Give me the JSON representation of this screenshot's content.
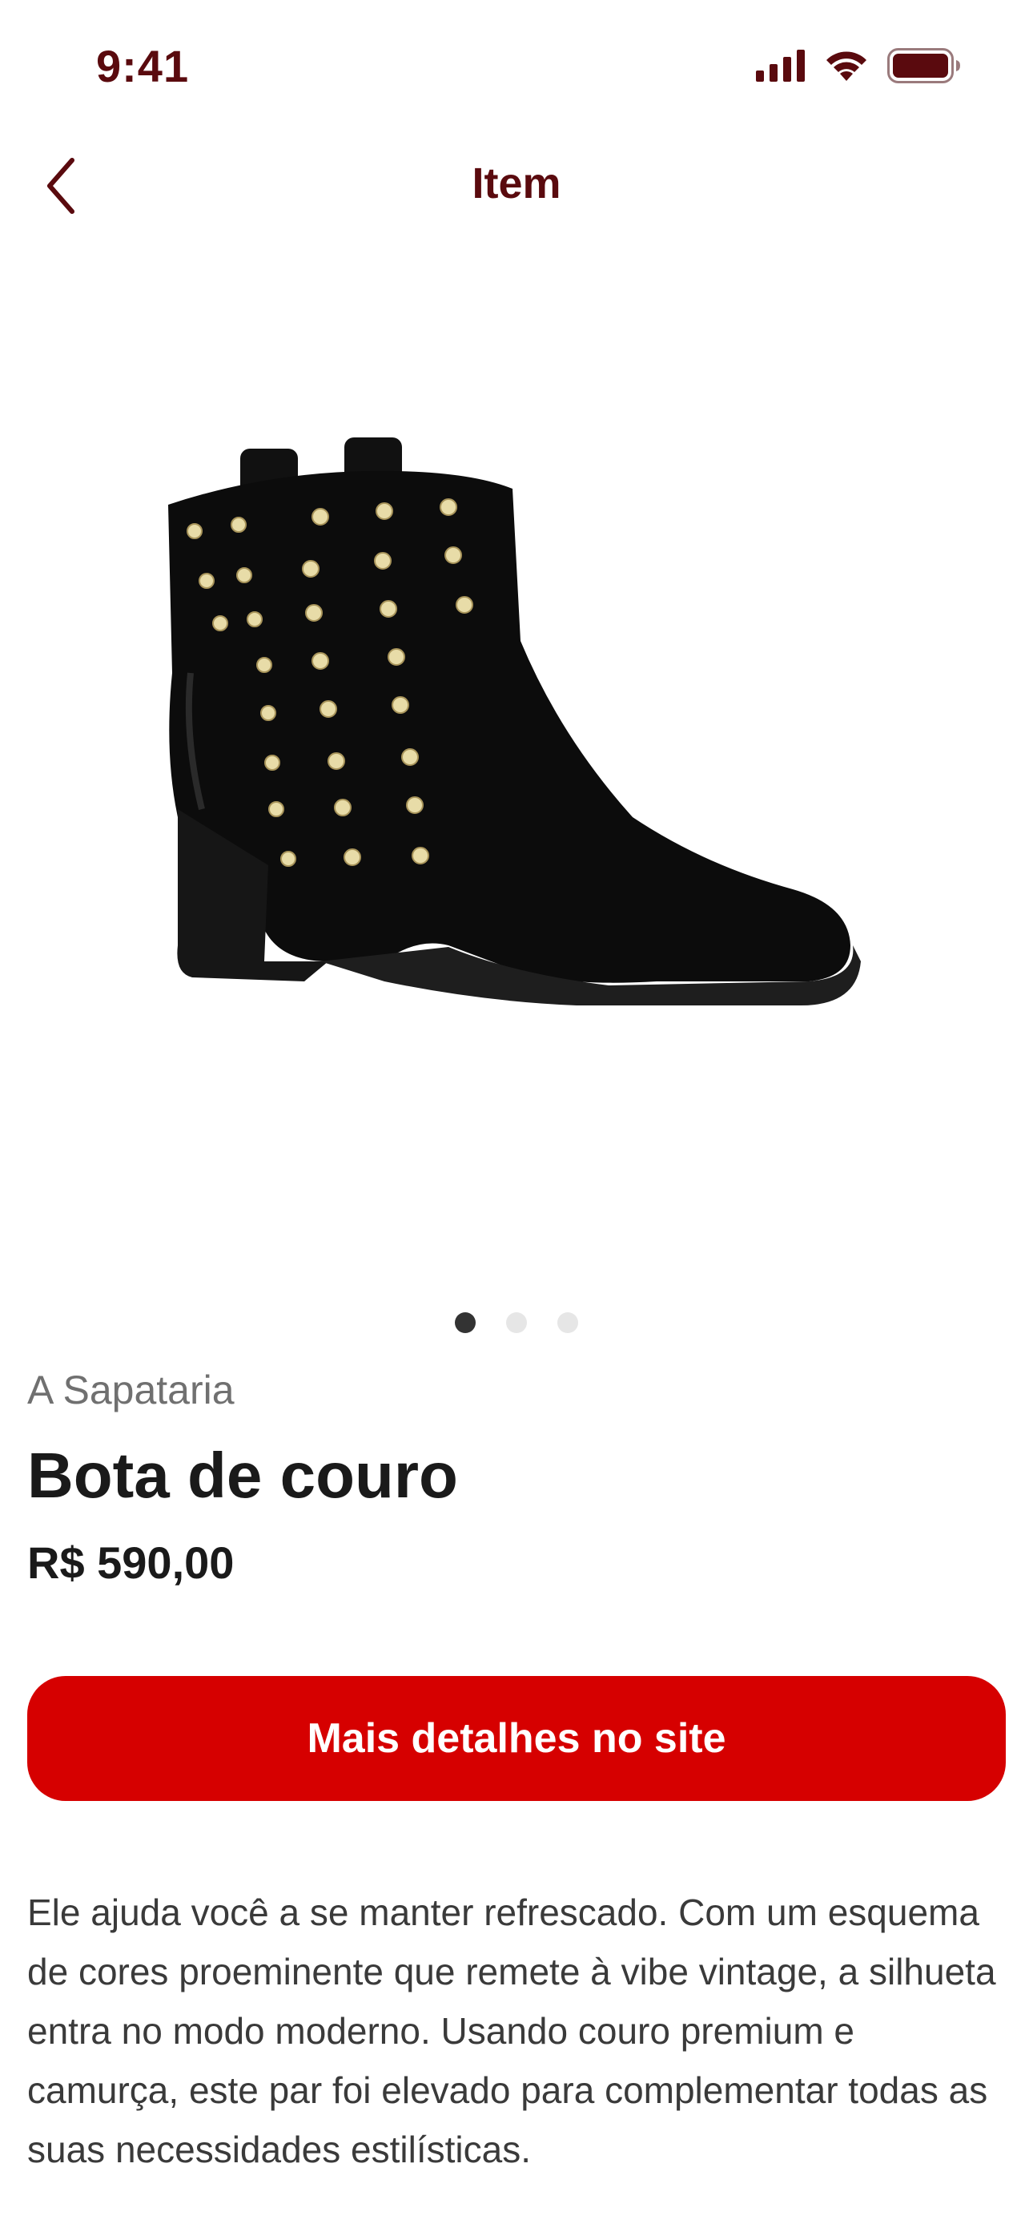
{
  "status_bar": {
    "time": "9:41",
    "icons": [
      "cellular-signal-icon",
      "wifi-icon",
      "battery-icon"
    ]
  },
  "header": {
    "title": "Item",
    "back_icon": "chevron-left-icon"
  },
  "carousel": {
    "total": 3,
    "active_index": 0
  },
  "product": {
    "store": "A Sapataria",
    "name": "Bota de couro",
    "price": "R$ 590,00",
    "cta_label": "Mais detalhes no site",
    "description": "Ele ajuda você a se manter refrescado. Com um esquema de cores proeminente que remete à vibe vintage, a silhueta entra no modo moderno. Usando couro premium e camurça, este par foi elevado para complementar todas as suas necessidades estilísticas."
  },
  "colors": {
    "brand_dark": "#5a0a0e",
    "cta_red": "#d60000",
    "text_primary": "#1a1a1a",
    "text_muted": "#707070"
  }
}
